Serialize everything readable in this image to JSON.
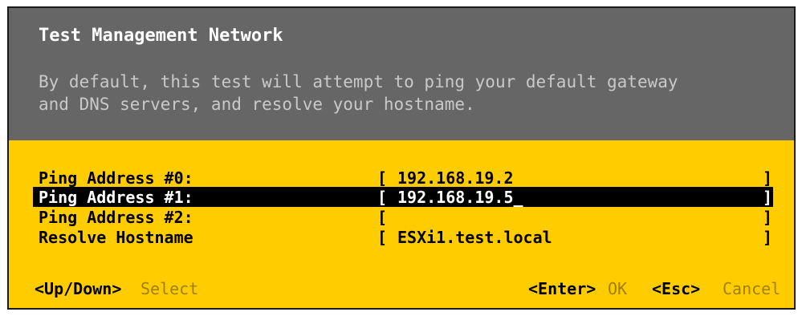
{
  "dialog": {
    "title": "Test Management Network",
    "description_line1": "By default, this test will attempt to ping your default gateway",
    "description_line2": "and DNS servers, and resolve your hostname."
  },
  "fields": [
    {
      "label": "Ping Address #0:",
      "value": "192.168.19.2",
      "selected": false
    },
    {
      "label": "Ping Address #1:",
      "value": "192.168.19.5_",
      "selected": true
    },
    {
      "label": "Ping Address #2:",
      "value": "",
      "selected": false
    },
    {
      "label": "Resolve Hostname",
      "value": "ESXi1.test.local",
      "selected": false
    }
  ],
  "brackets": {
    "open": "[",
    "close": "]"
  },
  "footer": {
    "nav_key": "<Up/Down>",
    "nav_action": "Select",
    "ok_key": "<Enter>",
    "ok_action": "OK",
    "cancel_key": "<Esc>",
    "cancel_action": "Cancel"
  },
  "colors": {
    "header_bg": "#666666",
    "content_bg": "#ffcc00",
    "selection_bg": "#000000",
    "action_text": "#a08000"
  }
}
